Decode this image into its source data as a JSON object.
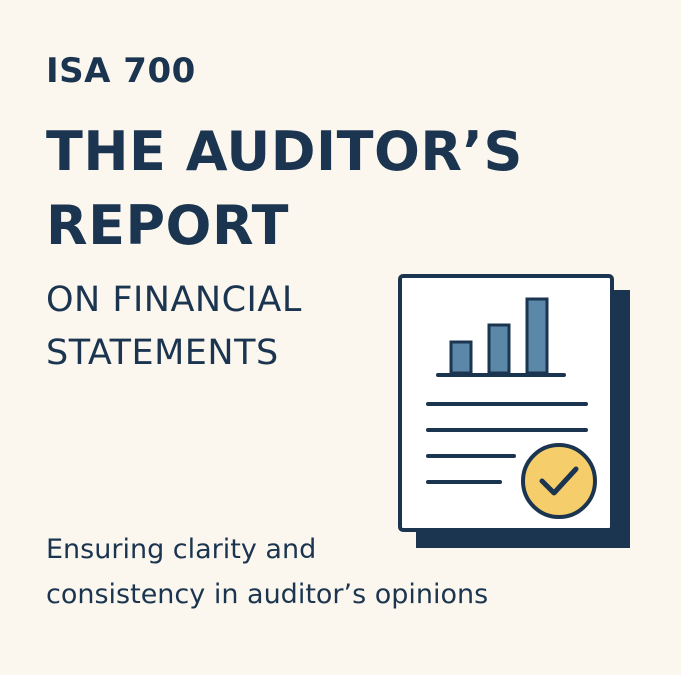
{
  "header": {
    "eyebrow": "ISA 700",
    "title_line_1": "THE AUDITOR’S",
    "title_line_2": "REPORT",
    "subtitle_line_1": "ON FINANCIAL",
    "subtitle_line_2": "STATEMENTS"
  },
  "tagline": {
    "line_1": "Ensuring clarity and",
    "line_2": "consistency in auditor’s opinions"
  },
  "illustration": {
    "icons": [
      "report-document-icon",
      "bar-chart-icon",
      "checkmark-badge-icon"
    ],
    "bar_levels": [
      0.42,
      0.65,
      1.0
    ]
  },
  "colors": {
    "background": "#FBF7EE",
    "ink": "#1B3550",
    "bar_fill": "#5B88A8",
    "badge_fill": "#F5CE6B",
    "paper": "#FFFFFF"
  }
}
